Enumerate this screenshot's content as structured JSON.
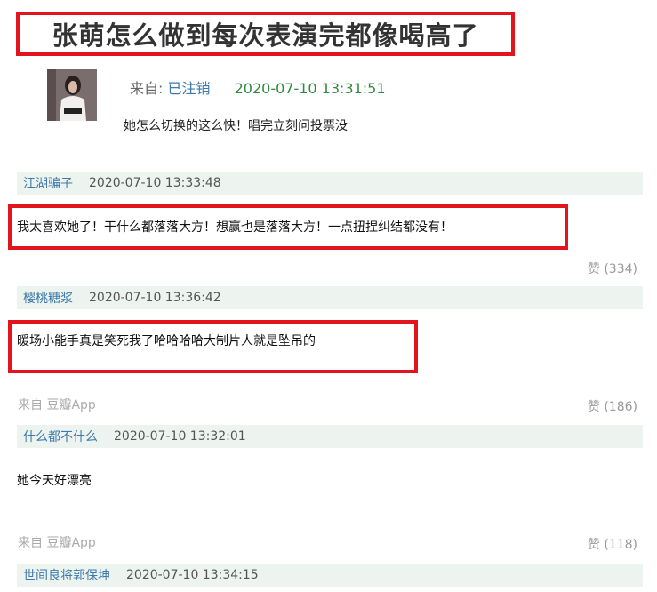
{
  "post": {
    "title": "张萌怎么做到每次表演完都像喝高了",
    "from_label": "来自:",
    "author": "已注销",
    "time": "2020-07-10 13:31:51",
    "text": "她怎么切换的这么快！唱完立刻问投票没"
  },
  "comments": [
    {
      "user": "江湖骗子",
      "time": "2020-07-10 13:33:48",
      "text": "我太喜欢她了！干什么都落落大方！想赢也是落落大方！一点扭捏纠结都没有！",
      "likes": "赞 (334)"
    },
    {
      "user": "樱桃糖浆",
      "time": "2020-07-10 13:36:42",
      "text": "暖场小能手真是笑死我了哈哈哈哈大制片人就是坠吊的",
      "source": "来自 豆瓣App",
      "likes": "赞 (186)"
    },
    {
      "user": "什么都不什么",
      "time": "2020-07-10 13:32:01",
      "text": "她今天好漂亮",
      "source": "来自 豆瓣App",
      "likes": "赞 (118)"
    },
    {
      "user": "世间良将郭保坤",
      "time": "2020-07-10 13:34:15"
    }
  ]
}
